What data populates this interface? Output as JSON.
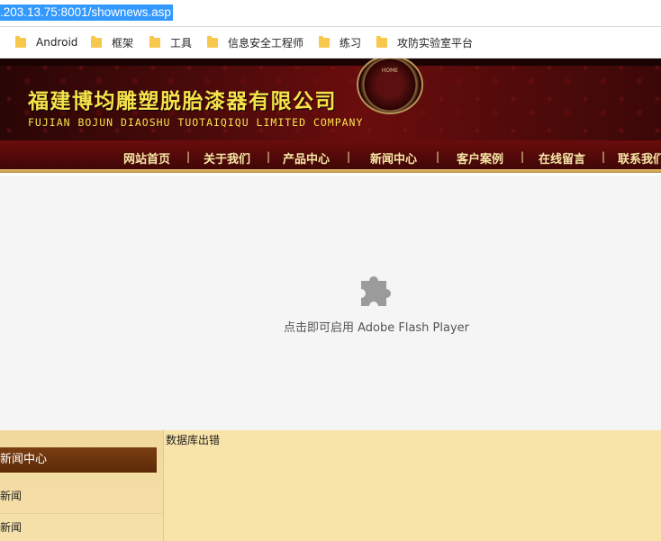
{
  "browser": {
    "url": ".203.13.75:8001/shownews.asp"
  },
  "bookmarks": [
    {
      "label": "Android"
    },
    {
      "label": "框架"
    },
    {
      "label": "工具"
    },
    {
      "label": "信息安全工程师"
    },
    {
      "label": "练习"
    },
    {
      "label": "攻防实验室平台"
    }
  ],
  "site": {
    "title_cn": "福建博均雕塑脱胎漆器有限公司",
    "title_en": "FUJIAN BOJUN DIAOSHU  TUOTAIQIQU  LIMITED COMPANY",
    "emblem_text": "HOME"
  },
  "nav": {
    "items": [
      "网站首页",
      "关于我们",
      "产品中心",
      "新闻中心",
      "客户案例",
      "在线留言",
      "联系我们"
    ]
  },
  "flash": {
    "prompt": "点击即可启用 Adobe Flash Player"
  },
  "sidebar": {
    "heading": "新闻中心",
    "items": [
      "新闻",
      "新闻"
    ]
  },
  "content": {
    "error": "数据库出错"
  },
  "colors": {
    "header_gold": "#f7e24a",
    "sidebar_bg": "#f8e3a8",
    "nav_text": "#f7e7a6"
  }
}
